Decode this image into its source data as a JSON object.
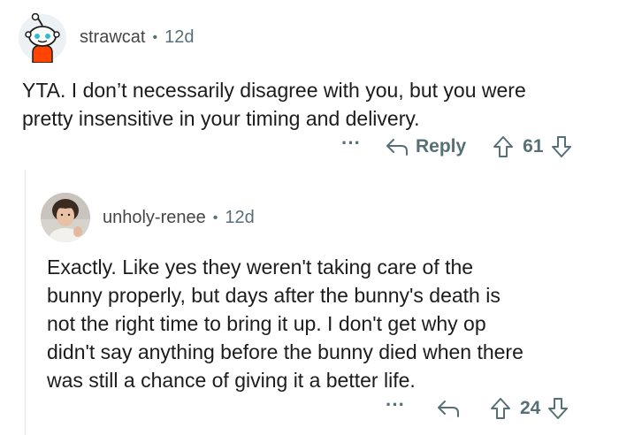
{
  "comments": [
    {
      "username": "strawcat",
      "separator": "•",
      "age": "12d",
      "avatar_icon": "snoo-avatar-icon",
      "text": "YTA. I don’t necessarily disagree with you, but you were\npretty insensitive in your timing and delivery.",
      "actions": {
        "more": "···",
        "reply_label": "Reply",
        "upvote_icon": "upvote-arrow-icon",
        "score": "61",
        "downvote_icon": "downvote-arrow-icon"
      }
    },
    {
      "username": "unholy-renee",
      "separator": "•",
      "age": "12d",
      "avatar_icon": "photo-avatar-icon",
      "text": "Exactly. Like yes they weren't taking care of the\nbunny properly, but days after the bunny's death is\nnot the right time to bring it up. I don't get why op\ndidn't say anything before the bunny died when there\nwas still a chance of giving it a better life.",
      "actions": {
        "more": "···",
        "reply_icon": "reply-arrow-icon",
        "upvote_icon": "upvote-arrow-icon",
        "score": "24",
        "downvote_icon": "downvote-arrow-icon"
      }
    }
  ],
  "colors": {
    "meta": "#576f76",
    "text": "#1c1c1c",
    "snoo_orange": "#ff4500",
    "thread_line": "#e5e5e5"
  }
}
